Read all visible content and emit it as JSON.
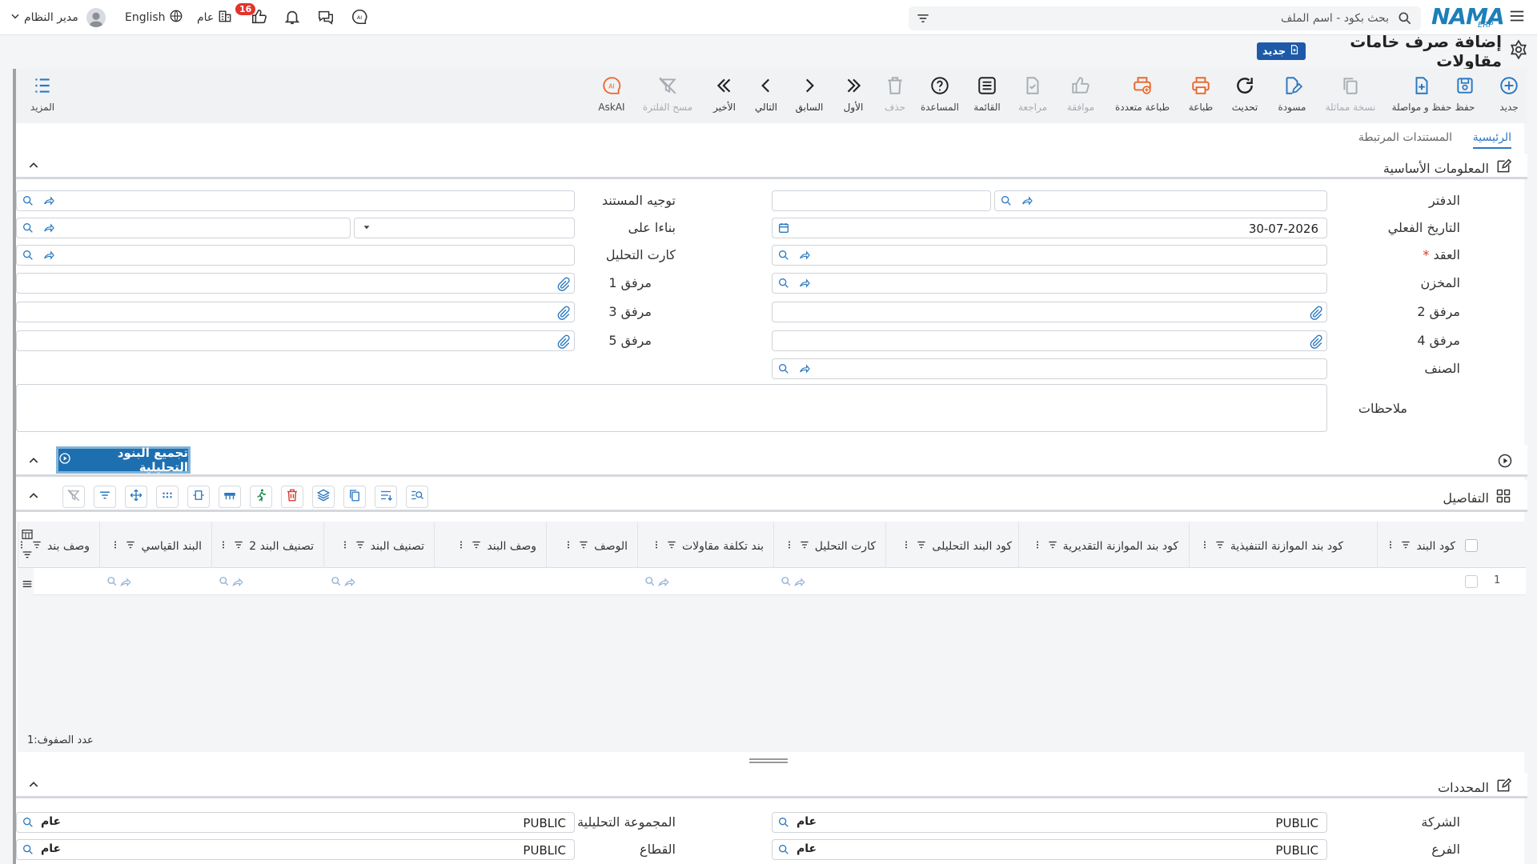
{
  "topbar": {
    "user_name": "مدير النظام",
    "language": "English",
    "scope": "عام",
    "notifications_count": "16",
    "search_placeholder": "بحث بكود - اسم الملف",
    "logo_text": "NAMA",
    "logo_sub": "ERP"
  },
  "page": {
    "title": "إضافة صرف خامات مقاولات",
    "badge": "جديد"
  },
  "toolbar": {
    "new": "جديد",
    "save": "حفظ",
    "save_continue": "حفظ و مواصلة",
    "duplicate": "نسخة مماثلة",
    "draft": "مسودة",
    "refresh": "تحديث",
    "print": "طباعة",
    "multi_print": "طباعة متعددة",
    "approve": "موافقة",
    "review": "مراجعة",
    "list": "القائمة",
    "help": "المساعدة",
    "delete": "حذف",
    "first": "الأول",
    "previous": "السابق",
    "next": "التالي",
    "last": "الأخير",
    "clear_filter": "مسح الفلترة",
    "askai": "AskAI",
    "more": "المزيد"
  },
  "tabs": {
    "main": "الرئيسية",
    "related": "المستندات المرتبطة"
  },
  "basic": {
    "header": "المعلومات الأساسية",
    "book": "الدفتر",
    "actual_date": "التاريخ الفعلي",
    "actual_date_value": "30-07-2026",
    "contract": "العقد",
    "warehouse": "المخزن",
    "attachment2": "مرفق 2",
    "attachment4": "مرفق 4",
    "item_class": "الصنف",
    "notes": "ملاحظات",
    "doc_direction": "توجيه المستند",
    "based_on": "بناءا على",
    "analysis_card": "كارت التحليل",
    "attachment1": "مرفق 1",
    "attachment3": "مرفق 3",
    "attachment5": "مرفق 5"
  },
  "collect_button": "تجميع البنود التحليلية",
  "details": {
    "header": "التفاصيل",
    "columns": [
      "كود البند",
      "كود بند الموازنة التنفيذية",
      "كود بند الموازنة التقديرية",
      "كود البند التحليلى",
      "كارت التحليل",
      "بند تكلفة مقاولات",
      "الوصف",
      "وصف البند",
      "تصنيف البند",
      "تصنيف البند 2",
      "البند القياسي",
      "وصف بند"
    ],
    "row_number": "1",
    "row_count_label": "عدد الصفوف:",
    "row_count": "1"
  },
  "dimensions": {
    "header": "المحددات",
    "company": "الشركة",
    "company_value": "PUBLIC",
    "company_tag": "عام",
    "branch": "الفرع",
    "branch_value": "PUBLIC",
    "branch_tag": "عام",
    "analytic_group": "المجموعة التحليلية",
    "analytic_group_value": "PUBLIC",
    "analytic_group_tag": "عام",
    "sector": "القطاع",
    "sector_value": "PUBLIC",
    "sector_tag": "عام"
  },
  "colors": {
    "accent": "#1e5aa8",
    "icon_blue": "#2a78c2",
    "icon_orange": "#e8672c",
    "icon_red": "#d9342b",
    "icon_green": "#1f8a4c"
  }
}
